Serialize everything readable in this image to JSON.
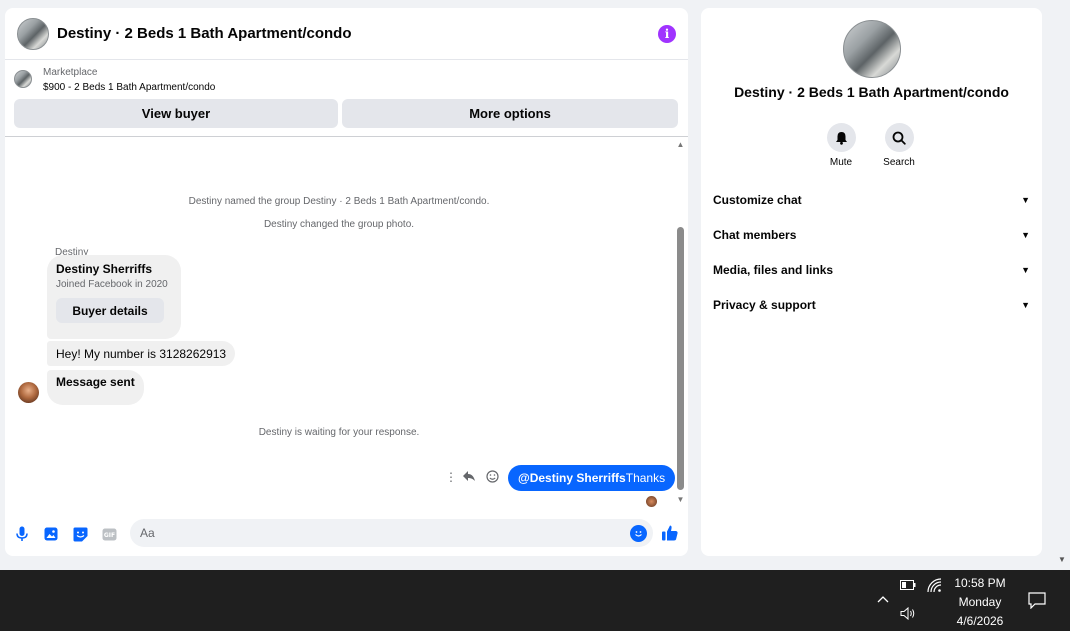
{
  "chat": {
    "title": "Destiny · 2 Beds 1 Bath Apartment/condo",
    "listing": {
      "label": "Marketplace",
      "price_title": "$900 - 2 Beds 1 Bath Apartment/condo",
      "view_buyer": "View buyer",
      "more_options": "More options"
    },
    "system_messages": [
      "Destiny named the group Destiny · 2 Beds 1 Bath Apartment/condo.",
      "Destiny changed the group photo.",
      "Destiny is waiting for your response."
    ],
    "sender": "Destiny",
    "buyer_card": {
      "name": "Destiny Sherriffs",
      "subtitle": "Joined Facebook in 2020",
      "button": "Buyer details"
    },
    "incoming": [
      "Hey! My number is 3128262913",
      "Message sent"
    ],
    "outgoing": {
      "mention": "@Destiny Sherriffs",
      "text": "Thanks"
    },
    "composer": {
      "placeholder": "Aa"
    }
  },
  "details": {
    "title": "Destiny · 2 Beds 1 Bath Apartment/condo",
    "actions": [
      {
        "label": "Mute",
        "icon": "bell-icon"
      },
      {
        "label": "Search",
        "icon": "search-icon"
      }
    ],
    "sections": [
      "Customize chat",
      "Chat members",
      "Media, files and links",
      "Privacy & support"
    ]
  },
  "taskbar": {
    "time": "10:58 PM",
    "day": "Monday",
    "date": "4/6/2026"
  },
  "colors": {
    "accent": "#0866ff",
    "info": "#a033ff"
  }
}
